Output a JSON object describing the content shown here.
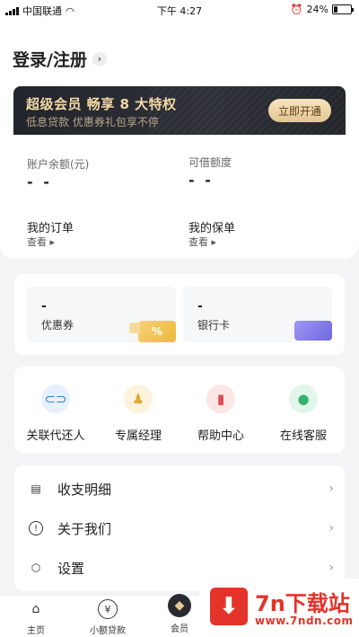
{
  "status_bar": {
    "carrier": "中国联通",
    "time": "下午 4:27",
    "battery": "24%",
    "battery_level": 0.24
  },
  "header": {
    "login_label": "登录/注册",
    "chevron": "›"
  },
  "vip": {
    "title": "超级会员  畅享 8 大特权",
    "subtitle": "低息贷款 优惠券礼包享不停",
    "button": "立即开通"
  },
  "account": {
    "balance_label": "账户余额(元)",
    "balance_value": "- -",
    "credit_label": "可借额度",
    "credit_value": "- -",
    "orders_title": "我的订单",
    "orders_link": "查看 ▸",
    "policy_title": "我的保单",
    "policy_link": "查看 ▸"
  },
  "wallet": {
    "coupon": {
      "value": "-",
      "label": "优惠券",
      "icon_text": "%"
    },
    "bank": {
      "value": "-",
      "label": "银行卡"
    }
  },
  "services": [
    {
      "label": "关联代还人",
      "icon": "link-icon"
    },
    {
      "label": "专属经理",
      "icon": "manager-icon"
    },
    {
      "label": "帮助中心",
      "icon": "book-icon"
    },
    {
      "label": "在线客服",
      "icon": "chat-icon"
    }
  ],
  "menu": [
    {
      "label": "收支明细",
      "icon": "document-icon"
    },
    {
      "label": "关于我们",
      "icon": "info-icon"
    },
    {
      "label": "设置",
      "icon": "settings-icon"
    }
  ],
  "tabbar": [
    {
      "label": "主页",
      "icon": "home-icon"
    },
    {
      "label": "小额贷款",
      "icon": "yen-icon"
    },
    {
      "label": "会员",
      "icon": "diamond-icon"
    }
  ],
  "watermark": {
    "title": "7n下载站",
    "url": "www.7ndn.com"
  },
  "colors": {
    "gold": "#f2d9a6",
    "accent_red": "#e4332a",
    "link_blue": "#3a7bd5"
  }
}
